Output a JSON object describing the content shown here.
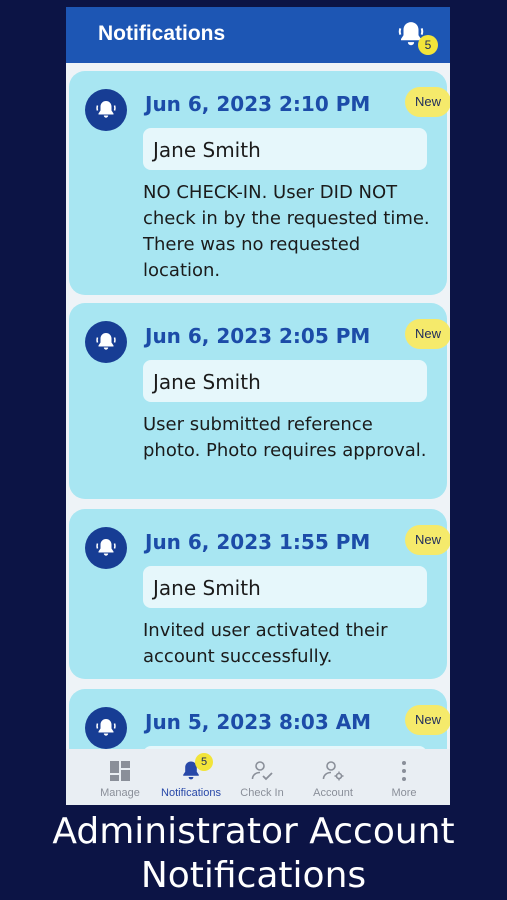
{
  "appbar": {
    "title": "Notifications",
    "badge_count": "5",
    "bell_icon": "bell-icon"
  },
  "notifications": [
    {
      "date": "Jun 6, 2023 2:10 PM",
      "badge": "New",
      "user": "Jane Smith",
      "message": "NO CHECK-IN. User DID NOT check in by the requested time. There was no requested location."
    },
    {
      "date": "Jun 6, 2023 2:05 PM",
      "badge": "New",
      "user": "Jane Smith",
      "message": "User submitted reference photo. Photo requires approval."
    },
    {
      "date": "Jun 6, 2023 1:55 PM",
      "badge": "New",
      "user": "Jane Smith",
      "message": "Invited user activated their account successfully."
    },
    {
      "date": "Jun 5, 2023 8:03 AM",
      "badge": "New",
      "user": "",
      "message": ""
    }
  ],
  "tabbar": {
    "items": [
      {
        "label": "Manage",
        "icon": "dashboard-icon"
      },
      {
        "label": "Notifications",
        "icon": "bell-icon",
        "badge": "5"
      },
      {
        "label": "Check In",
        "icon": "user-check-icon"
      },
      {
        "label": "Account",
        "icon": "user-gear-icon"
      },
      {
        "label": "More",
        "icon": "more-vertical-icon"
      }
    ],
    "active": "Notifications"
  },
  "caption": {
    "line1": "Administrator Account",
    "line2": "Notifications"
  },
  "colors": {
    "background": "#0c1445",
    "appbar": "#1d56b4",
    "card": "#a8e6f2",
    "new_badge": "#f5ea6b",
    "accent": "#2848a8"
  }
}
